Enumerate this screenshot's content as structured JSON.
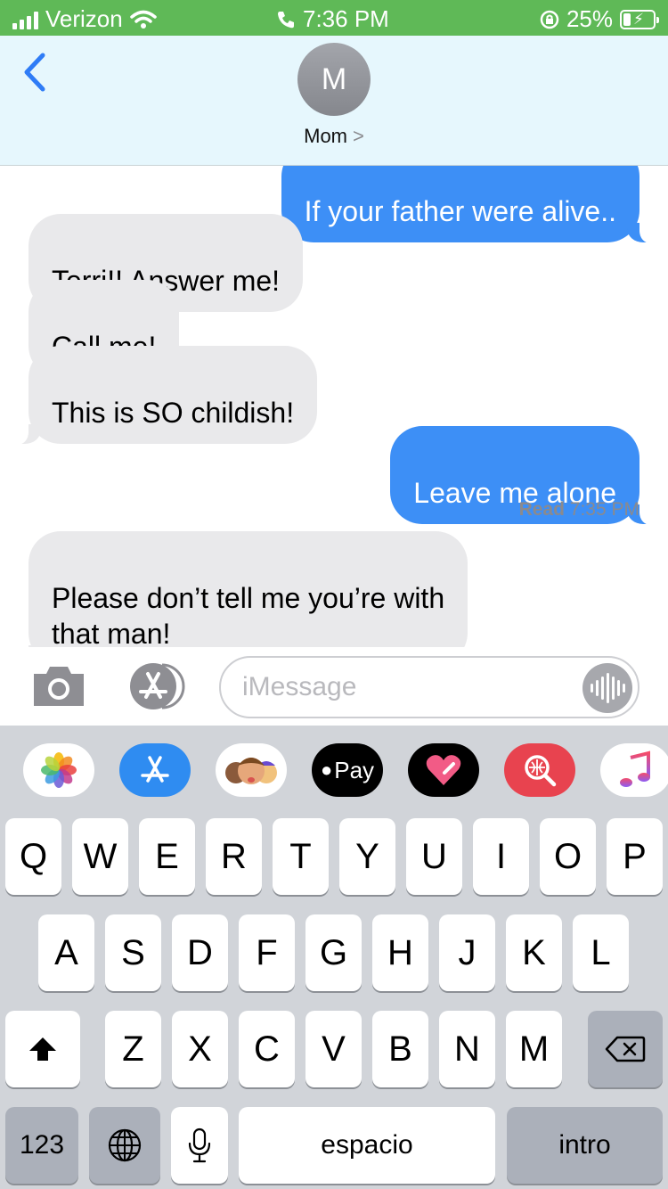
{
  "status_bar": {
    "carrier": "Verizon",
    "time": "7:36 PM",
    "battery": "25%",
    "icons": [
      "signal-icon",
      "wifi-icon",
      "phone-call-icon",
      "rotation-lock-icon",
      "battery-charging-icon"
    ]
  },
  "header": {
    "avatar_initial": "M",
    "contact_name": "Mom",
    "chevron": ">"
  },
  "messages": [
    {
      "from": "me",
      "text": "If your father were alive.."
    },
    {
      "from": "them",
      "text": "Terri!! Answer me!"
    },
    {
      "from": "them",
      "text": "Call me!"
    },
    {
      "from": "them",
      "text": "This is SO childish!"
    },
    {
      "from": "me",
      "text": "Leave me alone"
    },
    {
      "from": "them",
      "text": "Please don’t tell me you’re with\nthat man!"
    }
  ],
  "read_receipt": {
    "label": "Read",
    "time": "7:35 PM"
  },
  "input": {
    "placeholder": "iMessage"
  },
  "app_drawer": {
    "items": [
      "photos-app",
      "app-store-app",
      "memoji-app",
      "apple-pay-app",
      "digital-touch-app",
      "images-search-app",
      "music-app"
    ],
    "apple_pay_label": "Pay"
  },
  "keyboard": {
    "row1": [
      "Q",
      "W",
      "E",
      "R",
      "T",
      "Y",
      "U",
      "I",
      "O",
      "P"
    ],
    "row2": [
      "A",
      "S",
      "D",
      "F",
      "G",
      "H",
      "J",
      "K",
      "L"
    ],
    "row3": [
      "Z",
      "X",
      "C",
      "V",
      "B",
      "N",
      "M"
    ],
    "numbers_label": "123",
    "space_label": "espacio",
    "return_label": "intro"
  },
  "colors": {
    "status_bar": "#5fb957",
    "header_bg": "#e6f7fd",
    "bubble_out": "#3d8ff6",
    "bubble_in": "#e9e9eb",
    "keyboard_bg": "#d1d4d9"
  }
}
